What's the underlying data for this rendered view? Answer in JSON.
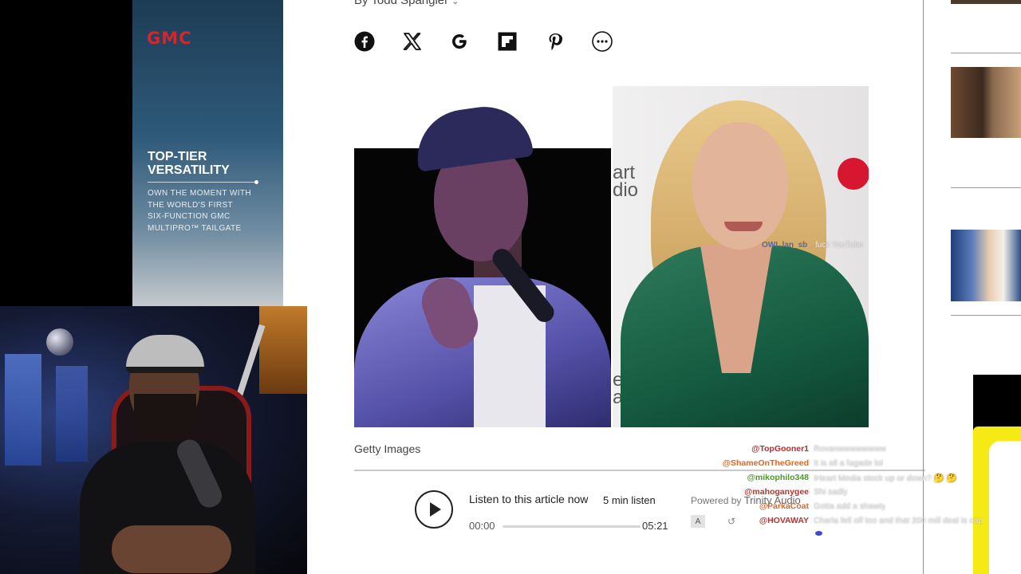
{
  "article": {
    "byline": "By Todd Spangler",
    "byline_chevron": "⌄",
    "image_caption": "Getty Images"
  },
  "share_icons": [
    "facebook-icon",
    "x-icon",
    "google-icon",
    "flipboard-icon",
    "pinterest-icon",
    "more-icon"
  ],
  "photo_left_logo": [],
  "photo_right_logo": [
    "art",
    "dio",
    "eart",
    "adio"
  ],
  "ad": {
    "brand": "GMC",
    "headline": "TOP-TIER\nVERSATILITY",
    "body": "OWN THE MOMENT WITH\nTHE WORLD'S FIRST\nSIX-FUNCTION GMC\nMULTIPRO™ TAILGATE",
    "brand_color": "#d3262d"
  },
  "audio_player": {
    "listen_label": "Listen to this article now",
    "duration_label": "5 min listen",
    "current_time": "00:00",
    "total_time": "05:21",
    "powered_by": "Powered by",
    "provider": "Trinity Audio",
    "progress": 0
  },
  "stream_overlay": {
    "floating_user": "OWI_lan_sb",
    "floating_message": "fuck YouTube",
    "chat": [
      {
        "user": "@TopGooner1",
        "color": "#c2272d",
        "message": "Rovanwwwwwwww"
      },
      {
        "user": "@ShameOnTheGreed",
        "color": "#e0661e",
        "message": "It is all a fagade lol"
      },
      {
        "user": "@mikophilo348",
        "color": "#4a9a2a",
        "message": "iHeart Media stock up or down? 🤔 🤔"
      },
      {
        "user": "@mahoganygee",
        "color": "#b5332b",
        "message": "Shi sadly"
      },
      {
        "user": "@ParkaCoat",
        "color": "#d66a2a",
        "message": "Gotta add a shawty"
      },
      {
        "user": "@HOVAWAY",
        "color": "#b5332b",
        "message": "Charla fell off too and that 200 mill deal is cap"
      }
    ]
  }
}
